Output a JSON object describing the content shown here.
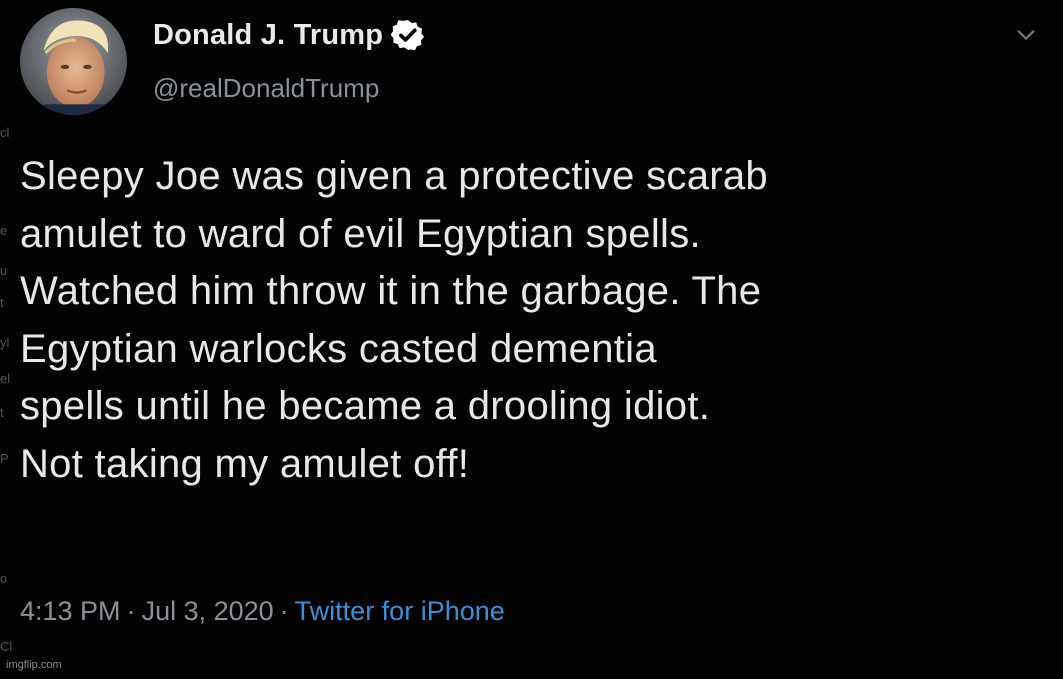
{
  "tweet": {
    "display_name": "Donald J. Trump",
    "handle": "@realDonaldTrump",
    "verified": true,
    "text_lines": [
      "Sleepy Joe was given a protective scarab",
      "amulet to ward of evil Egyptian spells.",
      "Watched him throw it in the garbage. The",
      "Egyptian warlocks casted dementia",
      "spells until he became a drooling idiot.",
      "Not taking my amulet off!"
    ],
    "time": "4:13 PM",
    "date": "Jul 3, 2020",
    "separator": "·",
    "source": "Twitter for iPhone"
  },
  "watermark": "imgflip.com",
  "colors": {
    "background": "#030303",
    "text": "#e8e8e8",
    "muted": "#8b9198",
    "link": "#3c8fd6",
    "verified": "#ffffff"
  },
  "icons": {
    "verified": "verified-badge-icon",
    "more": "chevron-down-icon"
  }
}
